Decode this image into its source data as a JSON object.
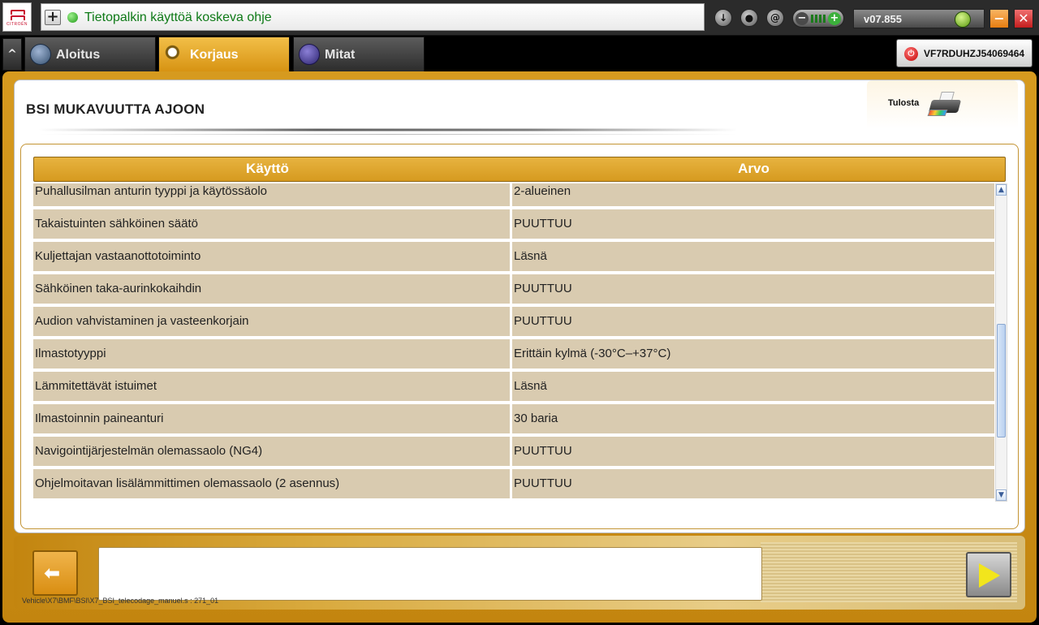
{
  "topbar": {
    "brand": "CITROËN",
    "help_plus": "+",
    "help_text": "Tietopalkin käyttöä koskeva ohje",
    "icons": [
      "download-icon",
      "user-icon",
      "at-icon"
    ],
    "version": "v07.855",
    "minimize_label": "−",
    "close_label": "✕"
  },
  "tabs": [
    {
      "label": "Aloitus",
      "icon": "home-dial-icon"
    },
    {
      "label": "Korjaus",
      "icon": "magnifier-icon"
    },
    {
      "label": "Mitat",
      "icon": "waveform-icon"
    }
  ],
  "vin": "VF7RDUHZJ54069464",
  "panel": {
    "title": "BSI  MUKAVUUTTA AJOON",
    "print_label": "Tulosta"
  },
  "table": {
    "headers": [
      "Käyttö",
      "Arvo"
    ],
    "rows": [
      {
        "name": "Puhallusilman anturin tyyppi ja käytössäolo",
        "value": "2-alueinen"
      },
      {
        "name": "Takaistuinten sähköinen säätö",
        "value": "PUUTTUU"
      },
      {
        "name": "Kuljettajan vastaanottotoiminto",
        "value": "Läsnä"
      },
      {
        "name": "Sähköinen taka-aurinkokaihdin",
        "value": "PUUTTUU"
      },
      {
        "name": "Audion vahvistaminen ja vasteenkorjain",
        "value": "PUUTTUU"
      },
      {
        "name": "Ilmastotyyppi",
        "value": "Erittäin kylmä (-30°C–+37°C)"
      },
      {
        "name": "Lämmitettävät istuimet",
        "value": "Läsnä"
      },
      {
        "name": "Ilmastoinnin paineanturi",
        "value": "30 baria"
      },
      {
        "name": "Navigointijärjestelmän olemassaolo (NG4)",
        "value": "PUUTTUU"
      },
      {
        "name": "Ohjelmoitavan lisälämmittimen olemassaolo (2 asennus)",
        "value": "PUUTTUU"
      }
    ]
  },
  "bottom": {
    "path": "Vehicle\\X7\\BMF\\BSI\\X7_BSI_telecodage_manuel.s : 271_01",
    "message": ""
  }
}
